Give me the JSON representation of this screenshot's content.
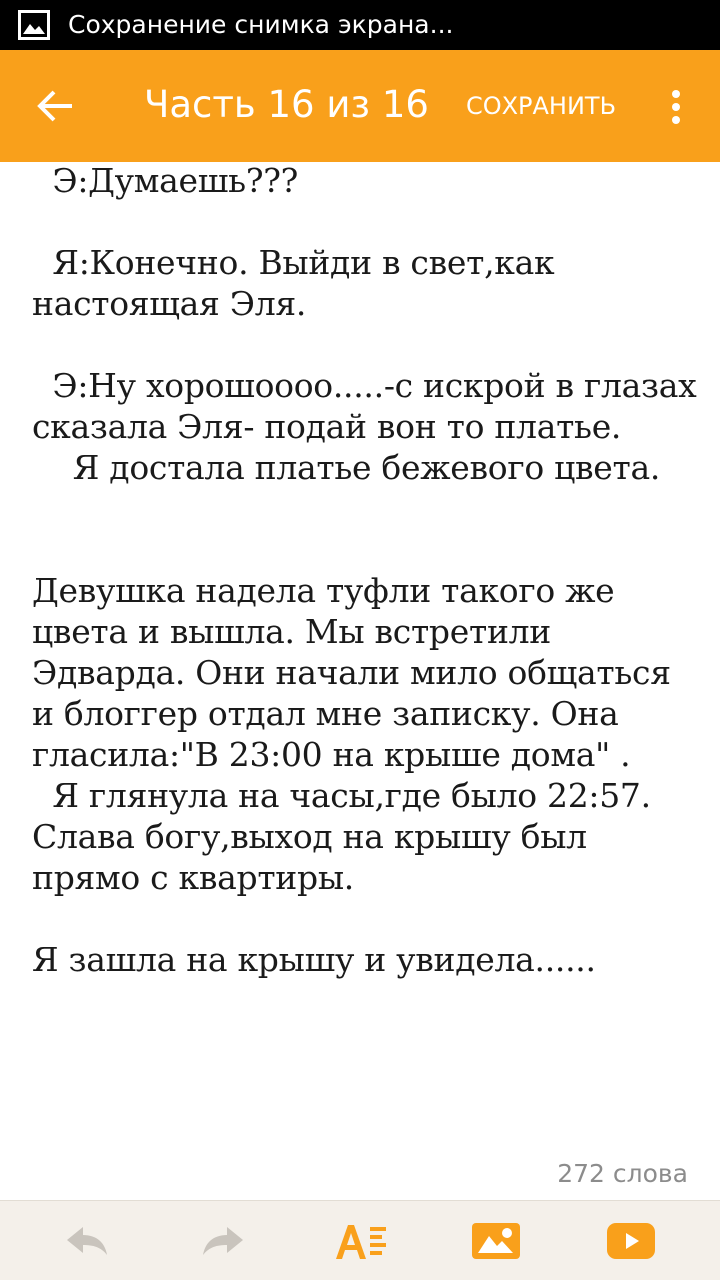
{
  "status_bar": {
    "notification_text": "Сохранение снимка экрана...",
    "icon": "image-icon"
  },
  "app_bar": {
    "title": "Часть 16 из 16",
    "save_label": "СОХРАНИТЬ",
    "back_icon": "arrow-left-icon",
    "menu_icon": "more-vertical-icon",
    "background_color": "#f9a01b"
  },
  "content": {
    "paragraphs": [
      "  Э:Думаешь???",
      "",
      "  Я:Конечно. Выйди в свет,как настоящая Эля.",
      "",
      "  Э:Ну хорошоооо.....-с искрой в глазах сказала Эля- подай вон то платье.",
      "    Я достала платье бежевого цвета.",
      "",
      "",
      "Девушка надела туфли такого же цвета и вышла. Мы встретили Эдварда. Они начали мило общаться и блоггер отдал мне записку. Она гласила:\"В 23:00 на крыше дома\" .",
      "  Я глянула на часы,где было 22:57. Слава богу,выход на крышу был прямо с квартиры.",
      "",
      "Я зашла на крышу и увидела......"
    ]
  },
  "footer": {
    "word_count": "272 слова"
  },
  "toolbar": {
    "icons": [
      "undo-icon",
      "redo-icon",
      "text-format-icon",
      "insert-image-icon",
      "insert-video-icon"
    ],
    "accent_color": "#f9a01b",
    "disabled_color": "#c9c4bd"
  }
}
